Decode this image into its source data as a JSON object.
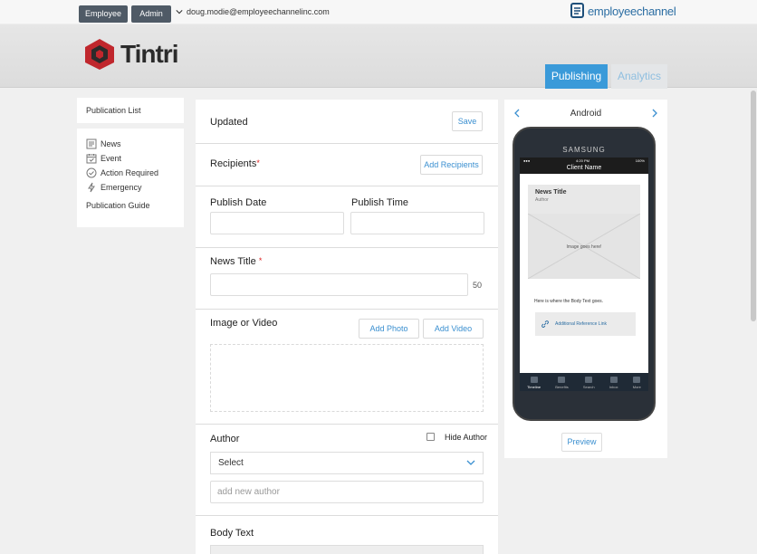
{
  "header": {
    "roles": [
      "Employee",
      "Admin"
    ],
    "user_email": "doug.modie@employeechannelinc.com",
    "brand_logo_text": "employeechannel",
    "client_logo_text": "Tintri",
    "tabs": {
      "publishing": "Publishing",
      "analytics": "Analytics"
    }
  },
  "sidebar": {
    "publication_list": "Publication List",
    "types": [
      {
        "label": "News",
        "icon": "news-icon"
      },
      {
        "label": "Event",
        "icon": "calendar-icon"
      },
      {
        "label": "Action Required",
        "icon": "check-circle-icon"
      },
      {
        "label": "Emergency",
        "icon": "lightning-icon"
      }
    ],
    "publication_guide": "Publication Guide"
  },
  "form": {
    "status_label": "Updated",
    "save_button": "Save",
    "recipients_label": "Recipients",
    "required_marker": "*",
    "add_recipients_button": "Add Recipients",
    "publish_date_label": "Publish Date",
    "publish_time_label": "Publish Time",
    "news_title_label": "News Title",
    "news_title_counter": "50",
    "image_or_video_label": "Image or Video",
    "add_photo_button": "Add Photo",
    "add_video_button": "Add Video",
    "author_label": "Author",
    "hide_author_label": "Hide Author",
    "author_select_value": "Select",
    "new_author_placeholder": "add new author",
    "body_text_label": "Body Text"
  },
  "preview": {
    "platform": "Android",
    "phone_brand": "SAMSUNG",
    "status_time": "4:20 PM",
    "battery": "100%",
    "client_name": "Client Name",
    "card_title": "News Title",
    "card_author": "Author",
    "image_placeholder": "Image goes here!",
    "body_text": "Here is where the Body Text goes.",
    "reference_link": "Additional Reference Link",
    "tabbar": [
      "Timeline",
      "Benefits",
      "Search",
      "Inbox",
      "More"
    ],
    "preview_button": "Preview"
  },
  "colors": {
    "accent": "#3a9ad9",
    "role_button": "#4f5a66",
    "required": "#dd2222"
  }
}
